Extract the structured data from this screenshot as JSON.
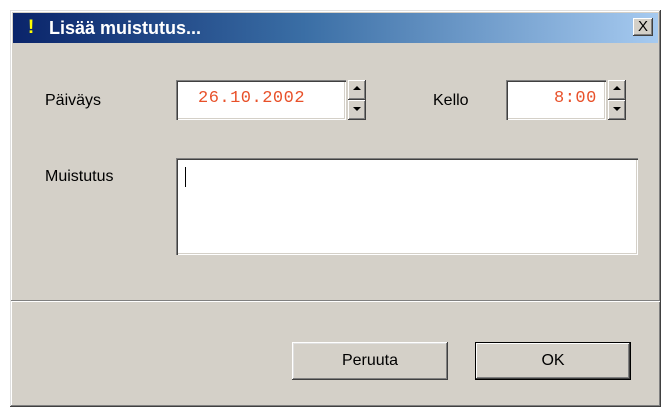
{
  "dialog": {
    "title": "Lisää muistutus...",
    "close_label": "X"
  },
  "form": {
    "date_label": "Päiväys",
    "date_value": "26.10.2002",
    "time_label": "Kello",
    "time_value": "8:00",
    "memo_label": "Muistutus",
    "memo_value": ""
  },
  "buttons": {
    "cancel_label": "Peruuta",
    "ok_label": "OK"
  },
  "icons": {
    "title_icon": "exclamation-icon",
    "spin_up": "arrow-up-icon",
    "spin_down": "arrow-down-icon"
  },
  "colors": {
    "field_text": "#e8512a",
    "dialog_bg": "#d4d0c8",
    "titlebar_start": "#0a246a",
    "titlebar_end": "#a6caf0"
  }
}
